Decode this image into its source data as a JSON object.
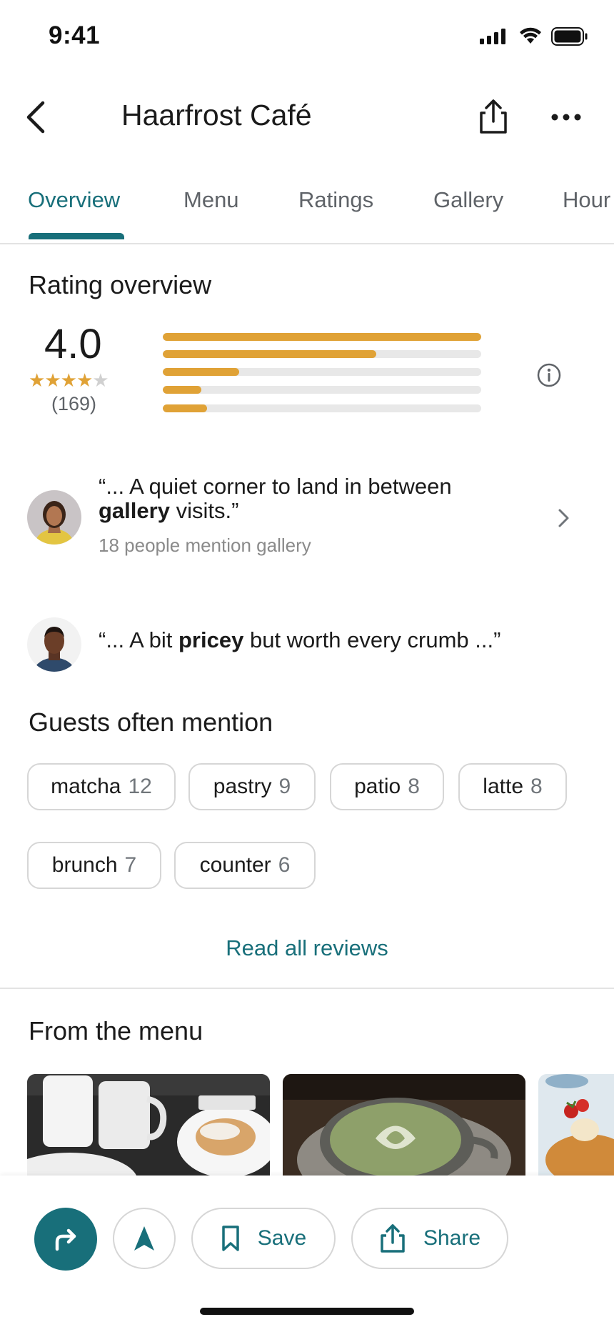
{
  "status_bar": {
    "time": "9:41"
  },
  "header": {
    "title": "Haarfrost Café"
  },
  "tabs": [
    {
      "label": "Overview",
      "active": true
    },
    {
      "label": "Menu"
    },
    {
      "label": "Ratings"
    },
    {
      "label": "Gallery"
    },
    {
      "label": "Hour"
    }
  ],
  "rating_overview": {
    "title": "Rating overview",
    "score": "4.0",
    "stars_filled": 4,
    "stars_total": 5,
    "count": "(169)",
    "distribution": [
      {
        "stars": 5,
        "fraction": 1.0
      },
      {
        "stars": 4,
        "fraction": 0.67
      },
      {
        "stars": 3,
        "fraction": 0.24
      },
      {
        "stars": 2,
        "fraction": 0.12
      },
      {
        "stars": 1,
        "fraction": 0.14
      }
    ]
  },
  "quotes": [
    {
      "pre": "“... A quiet corner to land in between ",
      "bold": "gallery",
      "post": " visits.”",
      "sub": "18 people mention gallery"
    },
    {
      "pre": "“... A bit ",
      "bold": "pricey",
      "post": " but worth every crumb ...”"
    }
  ],
  "mentions": {
    "title": "Guests often mention",
    "chips": [
      {
        "label": "matcha",
        "count": "12"
      },
      {
        "label": "pastry",
        "count": "9"
      },
      {
        "label": "patio",
        "count": "8"
      },
      {
        "label": "latte",
        "count": "8"
      },
      {
        "label": "brunch",
        "count": "7"
      },
      {
        "label": "counter",
        "count": "6"
      }
    ],
    "read_all": "Read all reviews"
  },
  "menu_section": {
    "title": "From the menu"
  },
  "actions": {
    "directions_icon": "turn-right-arrow-icon",
    "start_icon": "navigation-arrow-icon",
    "save_label": "Save",
    "share_label": "Share"
  },
  "colors": {
    "accent": "#186f7a",
    "star": "#e0a236",
    "bar_track": "#e8e8e8"
  }
}
